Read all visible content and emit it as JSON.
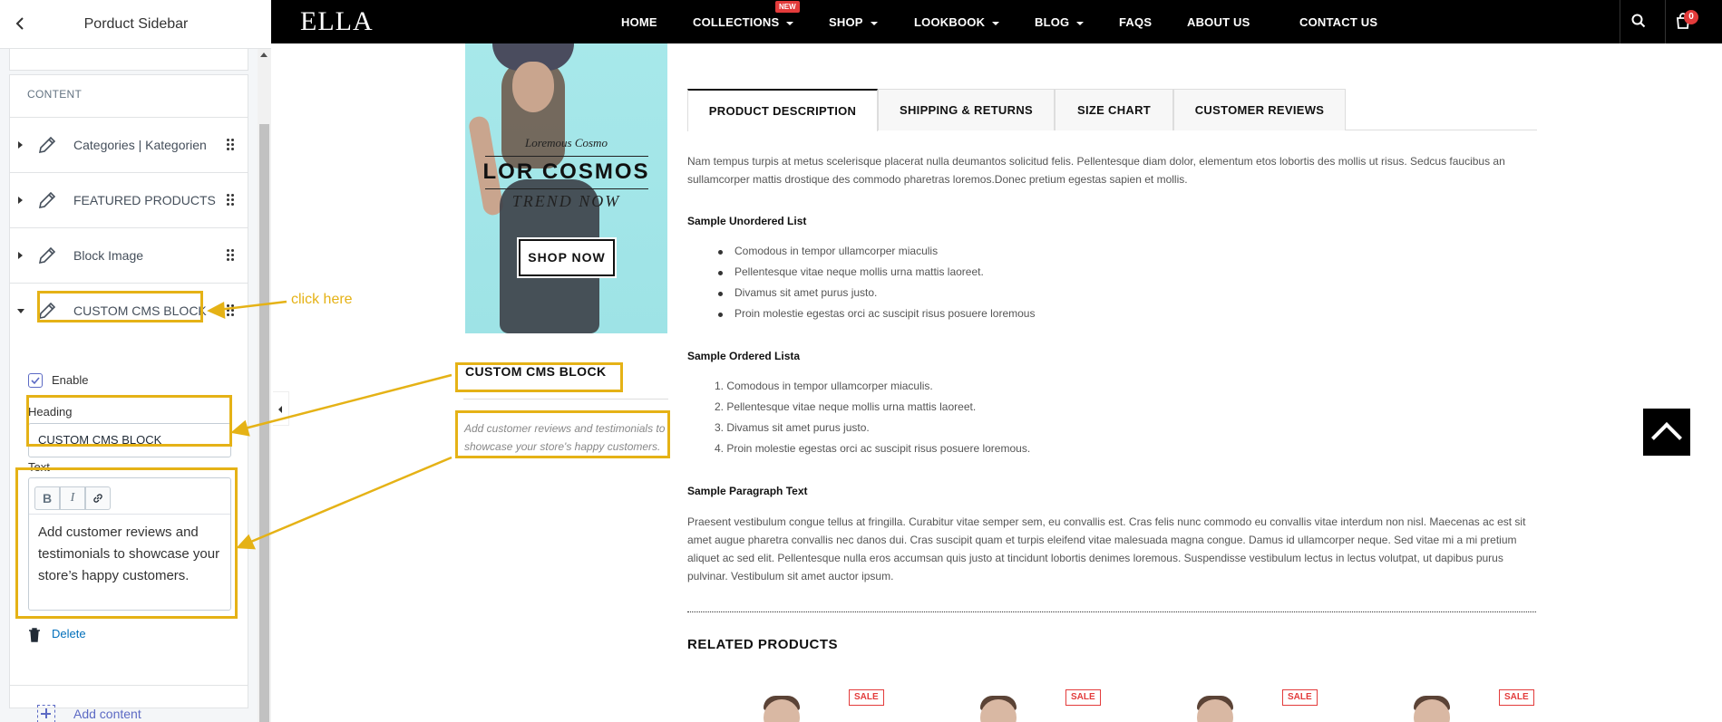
{
  "sidebar": {
    "title": "Porduct Sidebar",
    "section_label": "CONTENT",
    "items": [
      {
        "label": "Categories | Kategorien"
      },
      {
        "label": "FEATURED PRODUCTS"
      },
      {
        "label": "Block Image"
      },
      {
        "label": "CUSTOM CMS BLOCK"
      }
    ],
    "enable_label": "Enable",
    "enable_checked": true,
    "heading_label": "Heading",
    "heading_value": "CUSTOM CMS BLOCK",
    "text_label": "Text",
    "toolbar": {
      "bold": "B",
      "italic": "I"
    },
    "text_value": "Add customer reviews and testimonials to showcase your store’s happy customers.",
    "delete_label": "Delete",
    "add_content_label": "Add content"
  },
  "annotation": {
    "click_here": "click here",
    "color": "#e5b216"
  },
  "store": {
    "logo": "ELLA",
    "nav": [
      "HOME",
      "COLLECTIONS",
      "SHOP",
      "LOOKBOOK",
      "BLOG",
      "FAQS",
      "ABOUT US",
      "CONTACT US"
    ],
    "new_badge": "NEW",
    "cart_count": "0",
    "banner": {
      "tagline": "Loremous Cosmo",
      "headline": "LOR COSMOS",
      "subline": "TREND NOW",
      "button": "SHOP NOW"
    },
    "cms_block": {
      "heading": "CUSTOM CMS BLOCK",
      "text": "Add customer reviews and testimonials to showcase your store's happy customers."
    },
    "tabs": [
      "PRODUCT DESCRIPTION",
      "SHIPPING & RETURNS",
      "SIZE CHART",
      "CUSTOMER REVIEWS"
    ],
    "description": "Nam tempus turpis at metus scelerisque placerat nulla deumantos solicitud felis. Pellentesque diam dolor, elementum etos lobortis des mollis ut risus. Sedcus faucibus an sullamcorper mattis drostique des commodo pharetras loremos.Donec pretium egestas sapien et mollis.",
    "unordered_title": "Sample Unordered List",
    "unordered_items": [
      "Comodous in tempor ullamcorper miaculis",
      "Pellentesque vitae neque mollis urna mattis laoreet.",
      "Divamus sit amet purus justo.",
      "Proin molestie egestas orci ac suscipit risus posuere loremous"
    ],
    "ordered_title": "Sample Ordered Lista",
    "ordered_items": [
      "1. Comodous in tempor ullamcorper miaculis.",
      "2. Pellentesque vitae neque mollis urna mattis laoreet.",
      "3. Divamus sit amet purus justo.",
      "4. Proin molestie egestas orci ac suscipit risus posuere loremous."
    ],
    "paragraph_title": "Sample Paragraph Text",
    "paragraph": "Praesent vestibulum congue tellus at fringilla. Curabitur vitae semper sem, eu convallis est. Cras felis nunc commodo eu convallis vitae interdum non nisl. Maecenas ac est sit amet augue pharetra convallis nec danos dui. Cras suscipit quam et turpis eleifend vitae malesuada magna congue. Damus id ullamcorper neque. Sed vitae mi a mi pretium aliquet ac sed elit. Pellentesque nulla eros accumsan quis justo at tincidunt lobortis denimes loremous. Suspendisse vestibulum lectus in lectus volutpat, ut dapibus purus pulvinar. Vestibulum sit amet auctor ipsum.",
    "related_title": "RELATED PRODUCTS",
    "sale_label": "SALE"
  }
}
